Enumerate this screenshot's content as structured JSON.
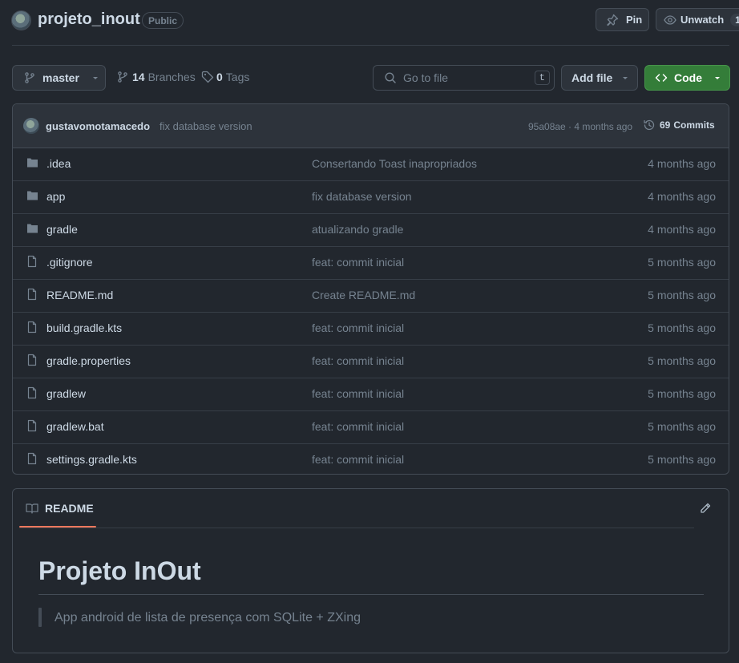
{
  "header": {
    "repo_name": "projeto_inout",
    "visibility": "Public",
    "pin_label": "Pin",
    "unwatch_label": "Unwatch",
    "unwatch_count": "1"
  },
  "toolbar": {
    "branch": "master",
    "branches_count": "14",
    "branches_label": "Branches",
    "tags_count": "0",
    "tags_label": "Tags",
    "go_to_file_placeholder": "Go to file",
    "shortcut_key": "t",
    "add_file_label": "Add file",
    "code_label": "Code",
    "code_color": "#347d39"
  },
  "commit": {
    "author": "gustavomotamacedo",
    "message": "fix database version",
    "hash_and_time": "95a08ae · 4 months ago",
    "commits_count": "69",
    "commits_label": "Commits"
  },
  "files": [
    {
      "name": ".idea",
      "type": "folder",
      "message": "Consertando Toast inapropriados",
      "date": "4 months ago"
    },
    {
      "name": "app",
      "type": "folder",
      "message": "fix database version",
      "date": "4 months ago"
    },
    {
      "name": "gradle",
      "type": "folder",
      "message": "atualizando gradle",
      "date": "4 months ago"
    },
    {
      "name": ".gitignore",
      "type": "file",
      "message": "feat: commit inicial",
      "date": "5 months ago"
    },
    {
      "name": "README.md",
      "type": "file",
      "message": "Create README.md",
      "date": "5 months ago"
    },
    {
      "name": "build.gradle.kts",
      "type": "file",
      "message": "feat: commit inicial",
      "date": "5 months ago"
    },
    {
      "name": "gradle.properties",
      "type": "file",
      "message": "feat: commit inicial",
      "date": "5 months ago"
    },
    {
      "name": "gradlew",
      "type": "file",
      "message": "feat: commit inicial",
      "date": "5 months ago"
    },
    {
      "name": "gradlew.bat",
      "type": "file",
      "message": "feat: commit inicial",
      "date": "5 months ago"
    },
    {
      "name": "settings.gradle.kts",
      "type": "file",
      "message": "feat: commit inicial",
      "date": "5 months ago"
    }
  ],
  "readme": {
    "tab_label": "README",
    "tab_underline_color": "#ec775c",
    "title": "Projeto InOut",
    "quote": "App android de lista de presença com SQLite + ZXing"
  }
}
